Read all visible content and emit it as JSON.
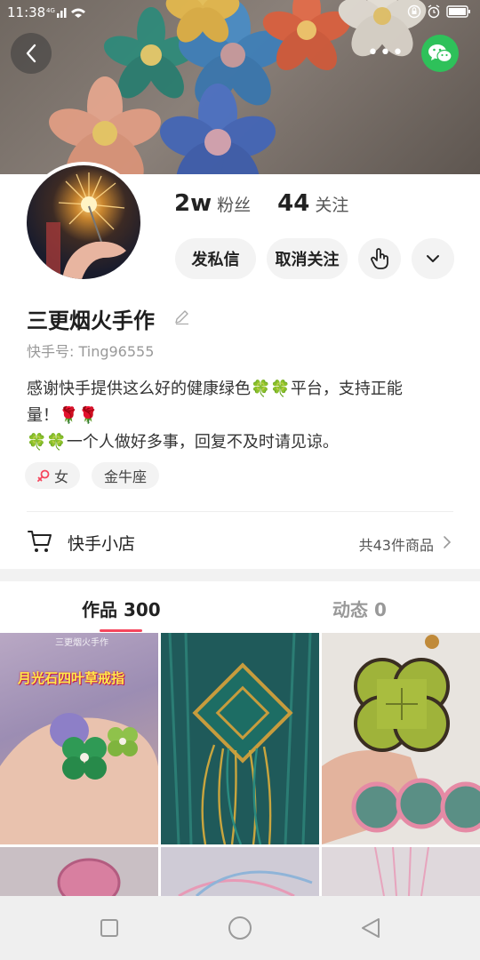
{
  "status_bar": {
    "time": "11:38",
    "network": "4G"
  },
  "header": {
    "back_icon": "chevron-left-icon",
    "more_label": "•••",
    "share_icon": "wechat-icon"
  },
  "profile": {
    "followers_value": "2w",
    "followers_label": "粉丝",
    "following_value": "44",
    "following_label": "关注",
    "message_label": "发私信",
    "unfollow_label": "取消关注",
    "poke_icon": "hand-pointer-icon",
    "dropdown_icon": "chevron-down-icon",
    "name": "三更烟火手作",
    "kuaishou_id": "快手号: Ting96555",
    "bio_lines": [
      "感谢快手提供这么好的健康绿色🍀🍀平台，支持正能",
      "量！🌹🌹",
      "🍀🍀一个人做好多事，回复不及时请见谅。"
    ],
    "tags": [
      "女",
      "金牛座"
    ]
  },
  "shop": {
    "label": "快手小店",
    "count": "共43件商品"
  },
  "tabs": [
    {
      "label": "作品 300",
      "active": true
    },
    {
      "label": "动态 0",
      "active": false
    }
  ],
  "grid": {
    "items": [
      {
        "caption": "月光石四叶草戒指",
        "watermark": "三更烟火手作"
      },
      {
        "caption": "",
        "watermark": ""
      },
      {
        "caption": "",
        "watermark": ""
      }
    ]
  },
  "colors": {
    "accent": "#f5465d",
    "wechat": "#2ec15a",
    "pill_bg": "#f3f3f3"
  },
  "nav": {
    "recent_icon": "square-icon",
    "home_icon": "circle-icon",
    "back_icon": "triangle-back-icon"
  }
}
